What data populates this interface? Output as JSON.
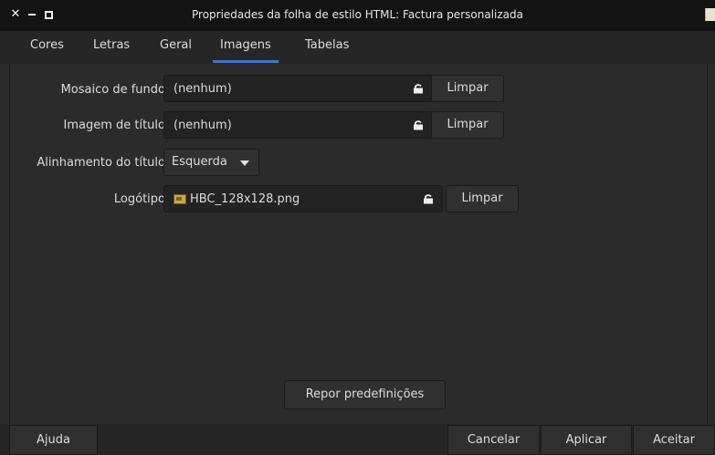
{
  "window": {
    "title": "Propriedades da folha de estilo HTML: Factura personalizada"
  },
  "tabs": [
    {
      "label": "Cores",
      "active": false
    },
    {
      "label": "Letras",
      "active": false
    },
    {
      "label": "Geral",
      "active": false
    },
    {
      "label": "Imagens",
      "active": true
    },
    {
      "label": "Tabelas",
      "active": false
    }
  ],
  "form": {
    "background_tile": {
      "label": "Mosaico de fundo",
      "value": "(nenhum)",
      "clear_label": "Limpar"
    },
    "heading_image": {
      "label": "Imagem de título",
      "value": "(nenhum)",
      "clear_label": "Limpar"
    },
    "heading_alignment": {
      "label": "Alinhamento do título",
      "value": "Esquerda"
    },
    "logo": {
      "label": "Logótipo",
      "value": "HBC_128x128.png",
      "clear_label": "Limpar"
    },
    "reset_label": "Repor predefinições"
  },
  "footer": {
    "help_label": "Ajuda",
    "cancel_label": "Cancelar",
    "apply_label": "Aplicar",
    "accept_label": "Aceitar"
  },
  "colors": {
    "accent": "#3c78c8",
    "background": "#2b2b2b",
    "titlebar": "#131313"
  },
  "icons": {
    "close": "close-icon",
    "minimize": "minimize-icon",
    "maximize": "maximize-icon",
    "file_chooser": "folder-open-icon",
    "image_file": "image-file-icon",
    "dropdown": "chevron-down-icon"
  }
}
